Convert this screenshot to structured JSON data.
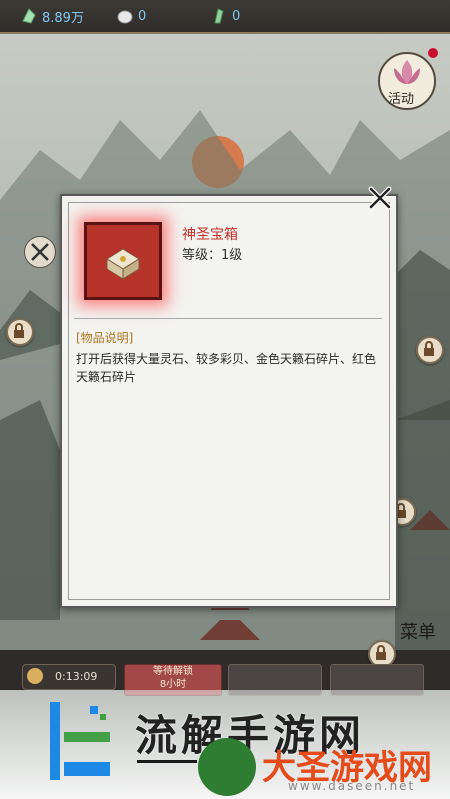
{
  "topbar": {
    "resources": [
      {
        "icon": "spirit-stone-icon",
        "value": "8.89万"
      },
      {
        "icon": "shell-icon",
        "value": "0"
      },
      {
        "icon": "jade-icon",
        "value": "0"
      }
    ]
  },
  "side": {
    "activity_label": "活动",
    "menu_label": "菜单"
  },
  "bottom": {
    "timer": "0:13:09",
    "waiting_line1": "等待解锁",
    "waiting_line2": "8小时"
  },
  "dialog": {
    "item_name": "神圣宝箱",
    "item_level": "等级：1级",
    "desc_heading": "[物品说明]",
    "desc_text": "打开后获得大量灵石、较多彩贝、金色天籁石碎片、红色天籁石碎片"
  },
  "watermark": {
    "title": "流解手游网",
    "brand": "大圣游戏网",
    "url": "www.daseen.net"
  },
  "colors": {
    "item_name": "#c4312a",
    "desc_heading": "#b0771f",
    "resource_value": "#7fc9f0"
  }
}
